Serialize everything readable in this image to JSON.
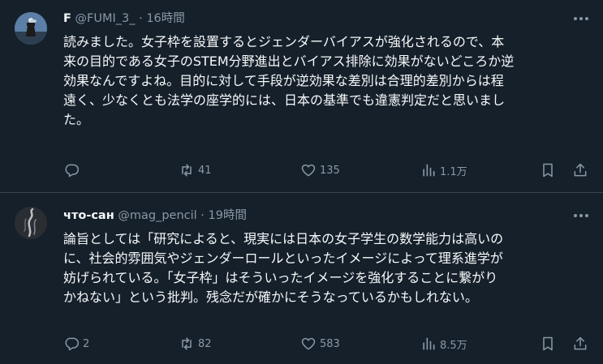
{
  "tweets": [
    {
      "name": "F",
      "handle": "@FUMI_3_",
      "dot": "·",
      "time": "16時間",
      "lines": [
        "読みました。女子枠を設置するとジェンダーバイアスが強化されるので、本",
        "来の目的である女子のSTEM分野進出とバイアス排除に効果がないどころか逆",
        "効果なんですよね。目的に対して手段が逆効果な差別は合理的差別からは程",
        "遠く、少なくとも法学の座学的には、日本の基準でも違憲判定だと思いまし",
        "た。"
      ],
      "replies": "",
      "retweets": "41",
      "likes": "135",
      "views": "1.1万"
    },
    {
      "name": "что-сан",
      "handle": "@mag_pencil",
      "dot": "·",
      "time": "19時間",
      "lines": [
        "論旨としては「研究によると、現実には日本の女子学生の数学能力は高いの",
        "に、社会的雰囲気やジェンダーロールといったイメージによって理系進学が",
        "妨げられている。「女子枠」はそういったイメージを強化することに繋がり",
        "かねない」という批判。残念だが確かにそうなっているかもしれない。"
      ],
      "replies": "2",
      "retweets": "82",
      "likes": "583",
      "views": "8.5万"
    }
  ],
  "colors": {
    "background": "#15202b",
    "text": "#f7f9f9",
    "muted": "#8b98a5",
    "divider": "#38444d"
  },
  "icons": [
    "more-icon",
    "reply-icon",
    "retweet-icon",
    "like-icon",
    "views-icon",
    "bookmark-icon",
    "share-icon"
  ]
}
